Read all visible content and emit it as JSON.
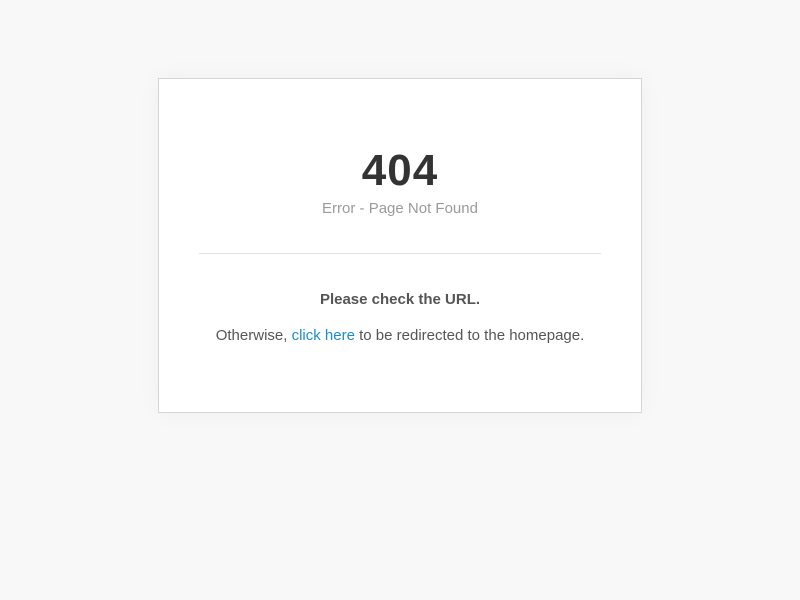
{
  "error": {
    "code": "404",
    "subtitle": "Error - Page Not Found",
    "check_message": "Please check the URL.",
    "redirect_prefix": "Otherwise, ",
    "redirect_link": "click here",
    "redirect_suffix": " to be redirected to the homepage."
  },
  "colors": {
    "background": "#f8f8f8",
    "card": "#ffffff",
    "link": "#1b8ccf",
    "code_text": "#333333",
    "muted_text": "#9a9a9a"
  }
}
